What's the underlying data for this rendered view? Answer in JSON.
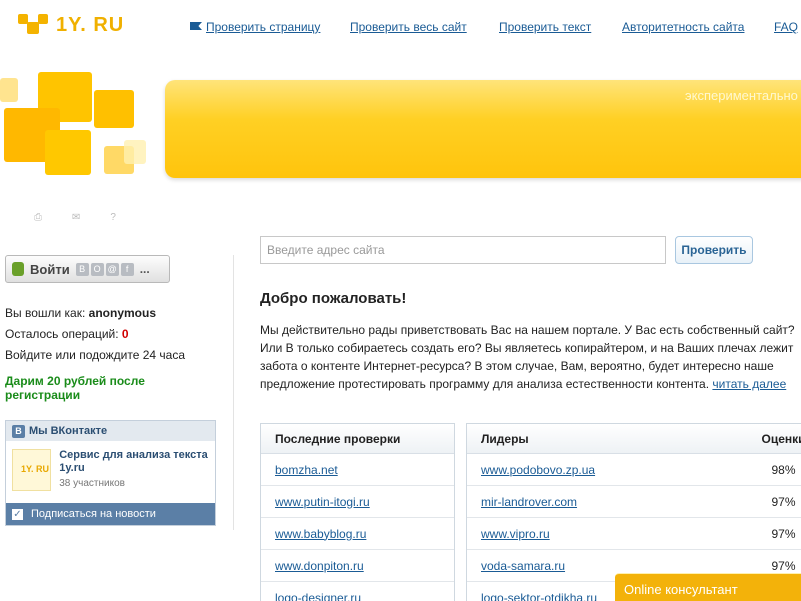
{
  "logo": {
    "text": "1Y. RU"
  },
  "nav": {
    "check_page": "Проверить страницу",
    "check_site": "Проверить весь сайт",
    "check_text": "Проверить текст",
    "authority": "Авторитетность сайта",
    "faq": "FAQ"
  },
  "banner": {
    "text": "экспериментально"
  },
  "login": {
    "button_label": "Войти",
    "social_icons": [
      "vk-icon",
      "ok-icon",
      "mail-icon",
      "facebook-icon"
    ],
    "more": "..."
  },
  "status": {
    "logged_as_label": "Вы вошли как:",
    "username": "anonymous",
    "ops_left_label": "Осталось операций:",
    "ops_left_value": "0",
    "wait_text": "Войдите или подождите 24 часа"
  },
  "promo": "Дарим 20 рублей после регистрации",
  "vk_widget": {
    "header": "Мы ВКонтакте",
    "group_title": "Сервис для анализа текста 1y.ru",
    "members": "38 участников",
    "subscribe": "Подписаться на новости"
  },
  "search": {
    "placeholder": "Введите адрес сайта",
    "button": "Проверить"
  },
  "welcome": {
    "title": "Добро пожаловать!",
    "text": "Мы действительно рады приветствовать Вас на нашем портале. У Вас есть собственный сайт? Или В только собираетесь создать его? Вы являетесь копирайтером, и на Ваших плечах лежит забота о контенте Интернет-ресурса? В этом случае, Вам, вероятно, будет интересно наше предложение протестировать программу для анализа естественности контента.",
    "read_more": "читать далее"
  },
  "recent_checks": {
    "header": "Последние проверки",
    "items": [
      "bomzha.net",
      "www.putin-itogi.ru",
      "www.babyblog.ru",
      "www.donpiton.ru",
      "logo-designer.ru"
    ]
  },
  "leaders": {
    "header_site": "Лидеры",
    "header_score": "Оценки",
    "rows": [
      {
        "site": "www.podobovo.zp.ua",
        "score": "98%"
      },
      {
        "site": "mir-landrover.com",
        "score": "97%"
      },
      {
        "site": "www.vipro.ru",
        "score": "97%"
      },
      {
        "site": "voda-samara.ru",
        "score": "97%"
      },
      {
        "site": "logo-sektor-otdikha.ru",
        "score": ""
      }
    ]
  },
  "consultant": "Online консультант",
  "colors": {
    "accent": "#f4b300",
    "link": "#1a5b95",
    "promo": "#1a8c1a",
    "vk": "#5b7fa6"
  }
}
